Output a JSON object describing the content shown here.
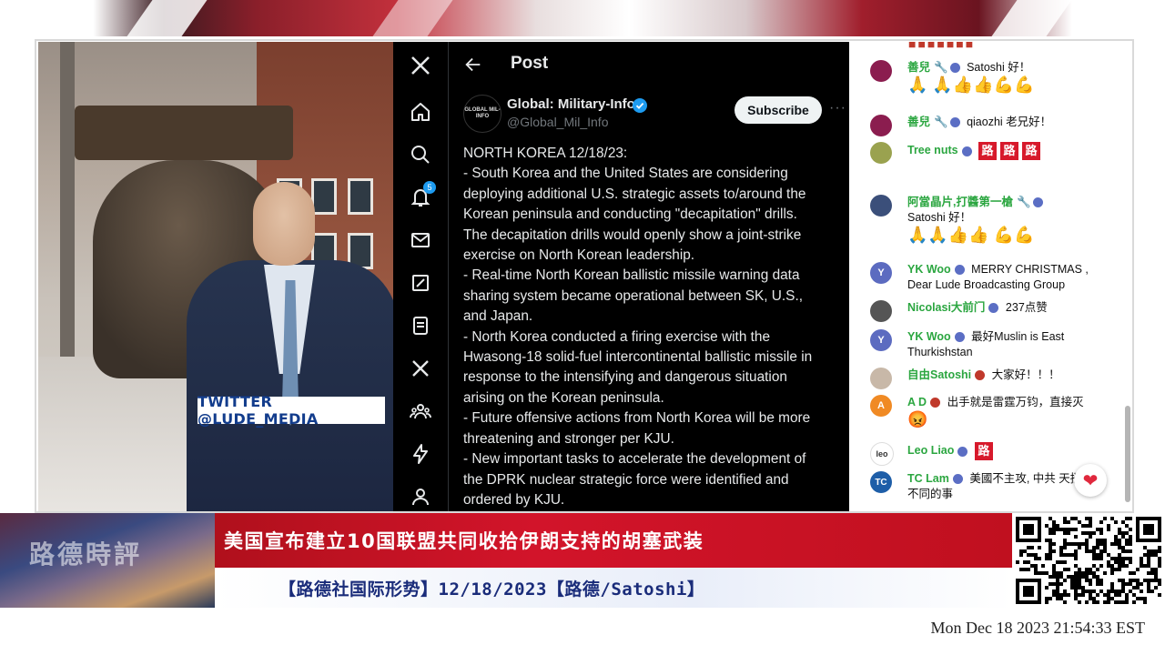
{
  "video": {
    "twitter_tag": "TWITTER @LUDE_MEDIA"
  },
  "x_app": {
    "nav": {
      "notifications_badge": "5",
      "icons": [
        "x-logo-icon",
        "home-icon",
        "search-icon",
        "bell-icon",
        "mail-icon",
        "grok-icon",
        "lists-icon",
        "premium-x-icon",
        "communities-icon",
        "lightning-icon",
        "profile-icon"
      ]
    },
    "header": {
      "title": "Post"
    },
    "author": {
      "name": "Global: Military-Info",
      "handle": "@Global_Mil_Info",
      "avatar_text": "GLOBAL MIL-INFO"
    },
    "subscribe_label": "Subscribe",
    "post_lines": [
      "NORTH KOREA 12/18/23:",
      " - South Korea and the United States are considering",
      "deploying additional U.S. strategic assets to/around the",
      "Korean peninsula and conducting \"decapitation\" drills.",
      "The decapitation drills would openly show a joint-strike",
      "exercise on North Korean leadership.",
      " - Real-time North Korean ballistic missile warning data",
      "sharing system became operational between SK, U.S.,",
      "and Japan.",
      " - North Korea conducted a firing exercise with the",
      "Hwasong-18 solid-fuel intercontinental ballistic missile in",
      "response to the intensifying and dangerous situation",
      "arising on the Korean peninsula.",
      " - Future offensive actions from North Korea will be more",
      "threatening and stronger per KJU.",
      " - New important tasks to accelerate the development of",
      "the DPRK nuclear strategic force were identified and",
      "ordered by KJU."
    ]
  },
  "chat": {
    "messages": [
      {
        "author": "善兒",
        "text": "Satoshi 好！",
        "emoji": "🙏 🙏👍👍💪💪"
      },
      {
        "author": "善兒",
        "text": "qiaozhi 老兄好！",
        "emoji": ""
      },
      {
        "author": "Tree nuts",
        "text": "",
        "emoji": "路路路"
      },
      {
        "author": "阿當晶片,打醬第一槍",
        "text": "Satoshi 好！",
        "emoji": "🙏🙏👍👍 💪💪"
      },
      {
        "author": "YK Woo",
        "text": "MERRY CHRISTMAS , Dear Lude Broadcasting Group",
        "emoji": "",
        "avatar": "Y"
      },
      {
        "author": "Nicolasi大前门",
        "text": "237点赞",
        "emoji": ""
      },
      {
        "author": "YK Woo",
        "text": "最好Muslin is East Thurkishstan",
        "emoji": "",
        "avatar": "Y"
      },
      {
        "author": "自由Satoshi",
        "text": "大家好！！！",
        "emoji": ""
      },
      {
        "author": "A D",
        "text": "出手就是雷霆万钧，直接灭",
        "emoji": "😡",
        "avatar": "A"
      },
      {
        "author": "Leo Liao",
        "text": "",
        "emoji": "路"
      },
      {
        "author": "TC Lam",
        "text": "美國不主攻, 中共 天擾不同的事",
        "emoji": "",
        "avatar": "TC"
      }
    ]
  },
  "lower_third": {
    "show_logo": "路德時評",
    "headline": "美国宣布建立10国联盟共同收拾伊朗支持的胡塞武装",
    "subline": "【路德社国际形势】12/18/2023【路德/Satoshi】"
  },
  "timestamp": "Mon Dec 18 2023 21:54:33 EST",
  "colors": {
    "headline_red": "#d2142a",
    "x_background": "#000000",
    "verified_blue": "#1d9bf0",
    "chat_author_green": "#2ba640"
  }
}
